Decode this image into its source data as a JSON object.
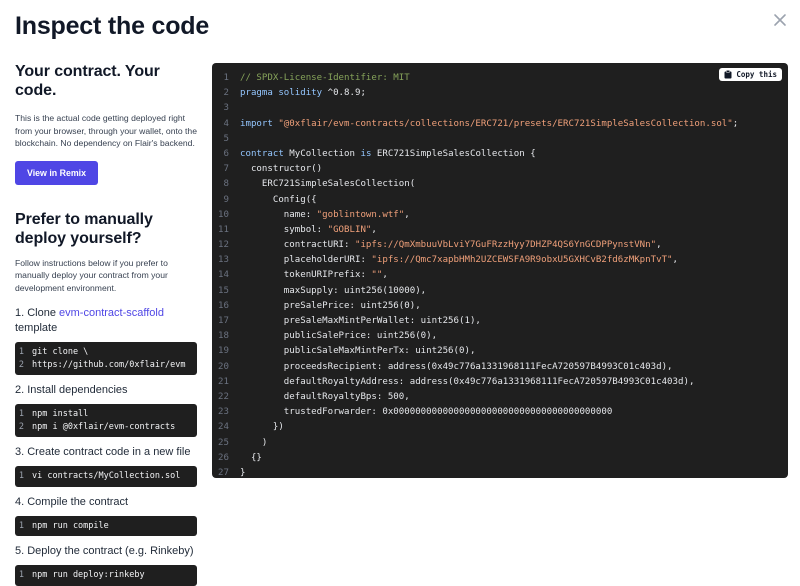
{
  "header": {
    "title": "Inspect the code"
  },
  "intro": {
    "heading": "Your contract. Your code.",
    "text": "This is the actual code getting deployed right from your browser, through your wallet, onto the blockchain. No dependency on Flair's backend.",
    "remix_label": "View in Remix"
  },
  "manual": {
    "heading": "Prefer to manually deploy yourself?",
    "text": "Follow instructions below if you prefer to manually deploy your contract from your development environment.",
    "steps": [
      {
        "prefix": "1. Clone ",
        "link": "evm-contract-scaffold",
        "suffix": "template",
        "lines": [
          "git clone \\",
          " https://github.com/0xflair/evm"
        ]
      },
      {
        "label": "2. Install dependencies",
        "lines": [
          "npm install",
          "npm i @0xflair/evm-contracts"
        ]
      },
      {
        "label": "3. Create contract code in a new file",
        "lines": [
          "vi contracts/MyCollection.sol"
        ]
      },
      {
        "label": "4. Compile the contract",
        "lines": [
          "npm run compile"
        ]
      },
      {
        "label": "5. Deploy the contract (e.g. Rinkeby)",
        "lines": [
          "npm run deploy:rinkeby"
        ]
      }
    ]
  },
  "code": {
    "copy_label": "Copy this",
    "lines": [
      [
        {
          "c": "// SPDX-License-Identifier: MIT",
          "s": "c"
        }
      ],
      [
        {
          "c": "pragma solidity ",
          "s": "k"
        },
        {
          "c": "^0.8.9;",
          "s": "p2"
        }
      ],
      [],
      [
        {
          "c": "import ",
          "s": "k"
        },
        {
          "c": "\"@0xflair/evm-contracts/collections/ERC721/presets/ERC721SimpleSalesCollection.sol\"",
          "s": "s"
        },
        {
          "c": ";",
          "s": "p2"
        }
      ],
      [],
      [
        {
          "c": "contract ",
          "s": "k"
        },
        {
          "c": "MyCollection ",
          "s": "p2"
        },
        {
          "c": "is ",
          "s": "k"
        },
        {
          "c": "ERC721SimpleSalesCollection {",
          "s": "p2"
        }
      ],
      [
        {
          "c": "  constructor()",
          "s": "p2"
        }
      ],
      [
        {
          "c": "    ERC721SimpleSalesCollection(",
          "s": "p2"
        }
      ],
      [
        {
          "c": "      Config({",
          "s": "p2"
        }
      ],
      [
        {
          "c": "        name: ",
          "s": "p2"
        },
        {
          "c": "\"goblintown.wtf\"",
          "s": "s"
        },
        {
          "c": ",",
          "s": "p2"
        }
      ],
      [
        {
          "c": "        symbol: ",
          "s": "p2"
        },
        {
          "c": "\"GOBLIN\"",
          "s": "s"
        },
        {
          "c": ",",
          "s": "p2"
        }
      ],
      [
        {
          "c": "        contractURI: ",
          "s": "p2"
        },
        {
          "c": "\"ipfs://QmXmbuuVbLviY7GuFRzzHyy7DHZP4QS6YnGCDPPynstVNn\"",
          "s": "s"
        },
        {
          "c": ",",
          "s": "p2"
        }
      ],
      [
        {
          "c": "        placeholderURI: ",
          "s": "p2"
        },
        {
          "c": "\"ipfs://Qmc7xapbHMh2UZCEWSFA9R9obxU5GXHCvB2fd6zMKpnTvT\"",
          "s": "s"
        },
        {
          "c": ",",
          "s": "p2"
        }
      ],
      [
        {
          "c": "        tokenURIPrefix: ",
          "s": "p2"
        },
        {
          "c": "\"\"",
          "s": "s"
        },
        {
          "c": ",",
          "s": "p2"
        }
      ],
      [
        {
          "c": "        maxSupply: uint256(10000),",
          "s": "p2"
        }
      ],
      [
        {
          "c": "        preSalePrice: uint256(0),",
          "s": "p2"
        }
      ],
      [
        {
          "c": "        preSaleMaxMintPerWallet: uint256(1),",
          "s": "p2"
        }
      ],
      [
        {
          "c": "        publicSalePrice: uint256(0),",
          "s": "p2"
        }
      ],
      [
        {
          "c": "        publicSaleMaxMintPerTx: uint256(0),",
          "s": "p2"
        }
      ],
      [
        {
          "c": "        proceedsRecipient: address(0x49c776a1331968111FecA720597B4993C01c403d),",
          "s": "p2"
        }
      ],
      [
        {
          "c": "        defaultRoyaltyAddress: address(0x49c776a1331968111FecA720597B4993C01c403d),",
          "s": "p2"
        }
      ],
      [
        {
          "c": "        defaultRoyaltyBps: 500,",
          "s": "p2"
        }
      ],
      [
        {
          "c": "        trustedForwarder: 0x0000000000000000000000000000000000000000",
          "s": "p2"
        }
      ],
      [
        {
          "c": "      })",
          "s": "p2"
        }
      ],
      [
        {
          "c": "    )",
          "s": "p2"
        }
      ],
      [
        {
          "c": "  {}",
          "s": "p2"
        }
      ],
      [
        {
          "c": "}",
          "s": "p2"
        }
      ]
    ]
  },
  "colors": {
    "accent": "#4f46e5",
    "code_bg": "#1f1f1f"
  }
}
